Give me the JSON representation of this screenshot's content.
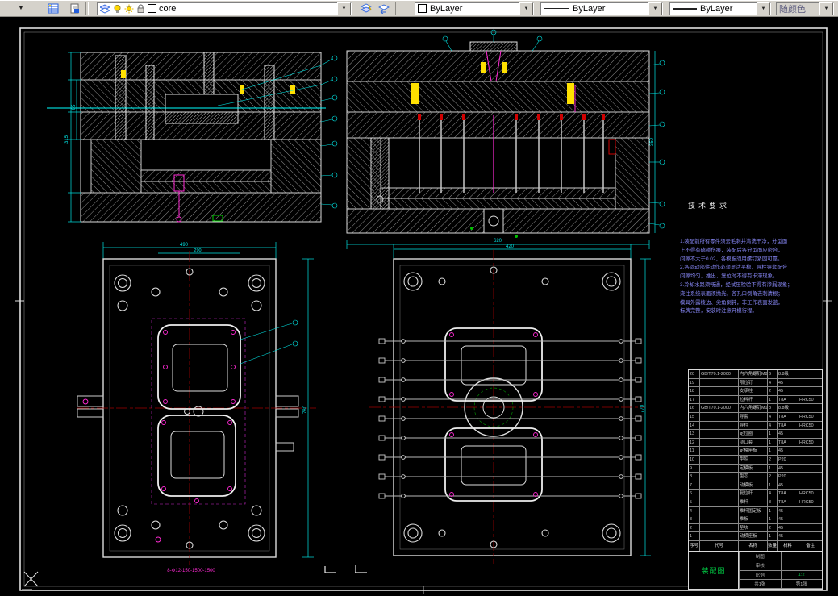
{
  "toolbar": {
    "layer": {
      "name": "core"
    },
    "color": {
      "value": "ByLayer"
    },
    "linetype": {
      "value": "ByLayer"
    },
    "lineweight": {
      "value": "ByLayer"
    },
    "plot_style": {
      "value": "随颜色"
    }
  },
  "colors": {
    "dim_cyan": "#00e5e5",
    "centerline_red": "#a00000",
    "detail_magenta": "#ff2ad4",
    "highlight_yellow": "#ffe000",
    "title_green": "#00cc44"
  },
  "tech_requirements": {
    "title": "技术要求",
    "lines": [
      "1.装配前所有零件须去毛刺并清洗干净，分型面",
      "上不得有磕碰伤痕，装配后各分型面应密合，",
      "间隙不大于0.02，各模板须用螺钉紧固可靠。",
      "2.各运动部件动作必须灵活平稳，导柱导套配合",
      "间隙均匀，推出、复位时不得有卡滞现象。",
      "3.冷却水路须畅通，经试压检验不得有渗漏现象；",
      "浇注系统表面须抛光，各孔口倒角去刺清根；",
      "模具外露棱边、尖角倒钝，非工作表面发蓝，",
      "标牌完整，安装时注意开模行程。"
    ]
  },
  "dims": {
    "a_left_h": "315",
    "a_left_w": "65",
    "b_right_h": "350",
    "b_bottom_w": "620",
    "c_top_w": "490",
    "c_top_w2": "290",
    "c_right_h": "780",
    "c_bottom_note": "8-Φ12-150-1500-1500",
    "d_top_w": "420",
    "d_right_h": "770"
  },
  "parts_table": {
    "headers": [
      "序号",
      "代号",
      "名称",
      "数量",
      "材料",
      "备注"
    ],
    "rows": [
      [
        "20",
        "GB/T70.1-2000",
        "内六角螺钉M8",
        "6",
        "8.8级",
        ""
      ],
      [
        "19",
        "",
        "限位钉",
        "4",
        "45",
        ""
      ],
      [
        "18",
        "",
        "支承柱",
        "2",
        "45",
        ""
      ],
      [
        "17",
        "",
        "拉料杆",
        "1",
        "T8A",
        "HRC50"
      ],
      [
        "16",
        "GB/T70.1-2000",
        "内六角螺钉M10",
        "8",
        "8.8级",
        ""
      ],
      [
        "15",
        "",
        "导套",
        "4",
        "T8A",
        "HRC50"
      ],
      [
        "14",
        "",
        "导柱",
        "4",
        "T8A",
        "HRC50"
      ],
      [
        "13",
        "",
        "定位圈",
        "1",
        "45",
        ""
      ],
      [
        "12",
        "",
        "浇口套",
        "1",
        "T8A",
        "HRC50"
      ],
      [
        "11",
        "",
        "定模座板",
        "1",
        "45",
        ""
      ],
      [
        "10",
        "",
        "型腔",
        "2",
        "P20",
        ""
      ],
      [
        "9",
        "",
        "定模板",
        "1",
        "45",
        ""
      ],
      [
        "8",
        "",
        "型芯",
        "2",
        "P20",
        ""
      ],
      [
        "7",
        "",
        "动模板",
        "1",
        "45",
        ""
      ],
      [
        "6",
        "",
        "复位杆",
        "4",
        "T8A",
        "HRC50"
      ],
      [
        "5",
        "",
        "推杆",
        "8",
        "T8A",
        "HRC50"
      ],
      [
        "4",
        "",
        "推杆固定板",
        "1",
        "45",
        ""
      ],
      [
        "3",
        "",
        "推板",
        "1",
        "45",
        ""
      ],
      [
        "2",
        "",
        "垫块",
        "2",
        "45",
        ""
      ],
      [
        "1",
        "",
        "动模座板",
        "1",
        "45",
        ""
      ]
    ]
  },
  "title_block": {
    "title": "装配图",
    "draw_label": "制图",
    "check_label": "审核",
    "scale_label": "比例",
    "scale": "1:2",
    "sheet": "共1张",
    "sheet2": "第1张"
  }
}
